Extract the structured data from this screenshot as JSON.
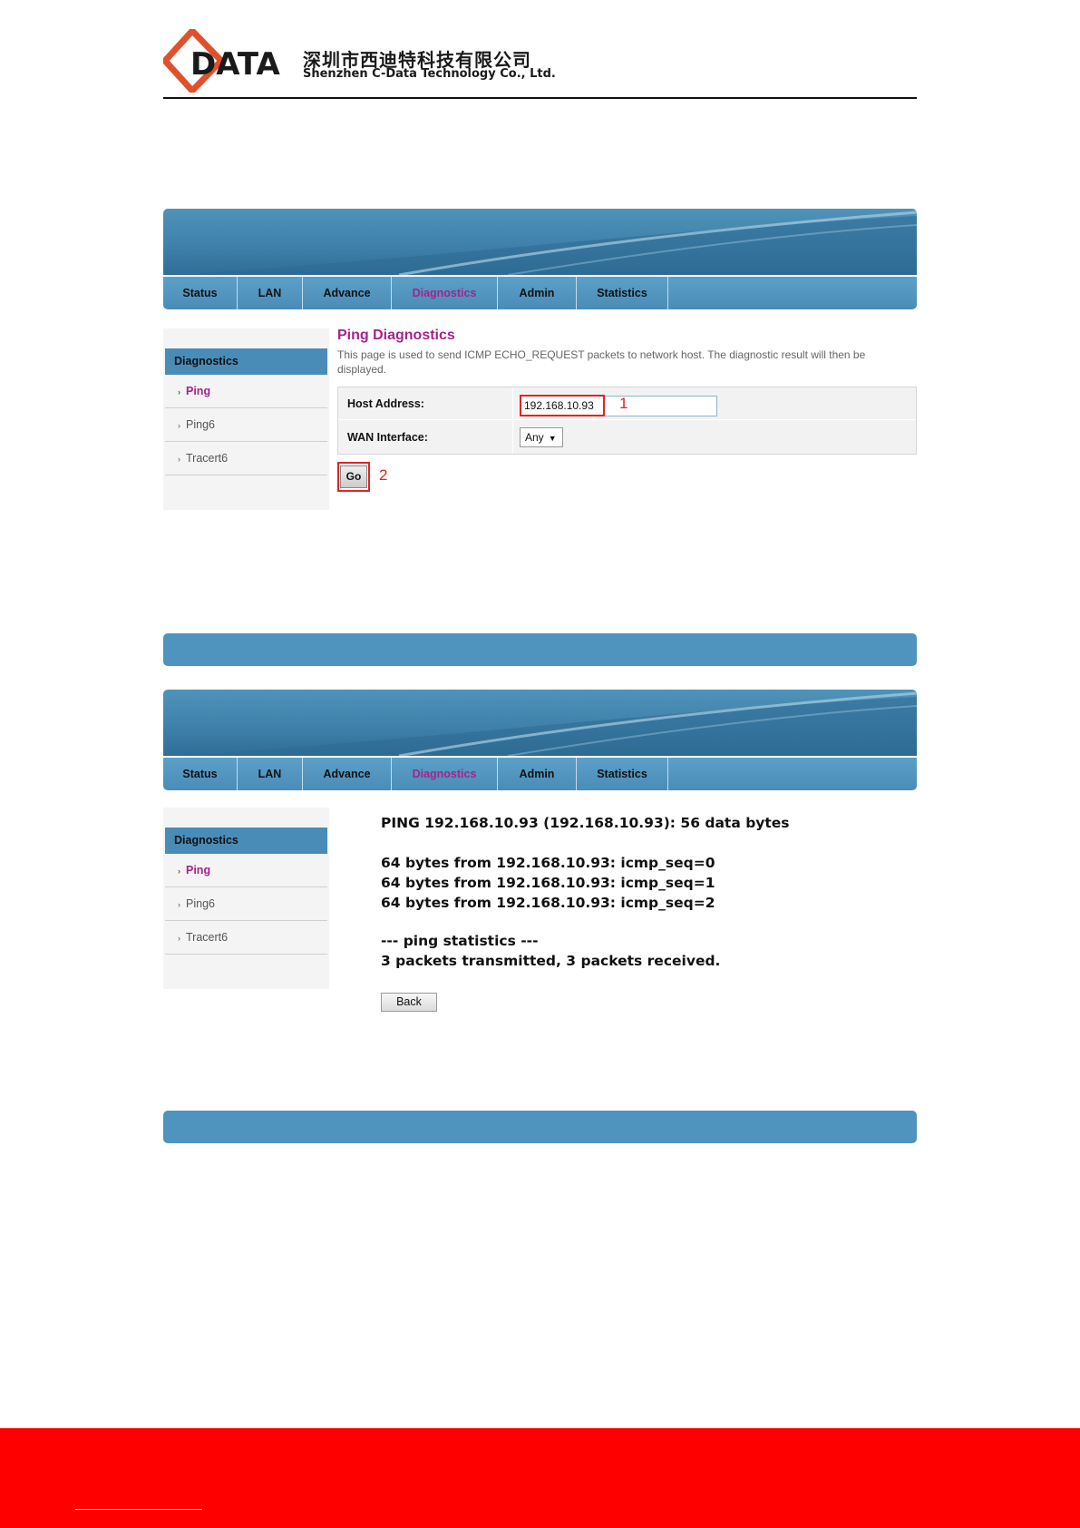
{
  "header": {
    "company_cn": "深圳市西迪特科技有限公司",
    "company_en": "Shenzhen C-Data Technology Co., Ltd.",
    "logo_text": "DATA"
  },
  "colors": {
    "accent_magenta": "#a3238e",
    "nav_blue": "#4a8cb8",
    "callout_red": "#e02424",
    "footer_red": "#ff0000"
  },
  "nav": {
    "tabs": [
      "Status",
      "LAN",
      "Advance",
      "Diagnostics",
      "Admin",
      "Statistics"
    ],
    "active": "Diagnostics"
  },
  "sidebar": {
    "title": "Diagnostics",
    "items": [
      "Ping",
      "Ping6",
      "Tracert6"
    ],
    "active": "Ping"
  },
  "ping_form": {
    "title": "Ping Diagnostics",
    "description": "This page is used to send ICMP ECHO_REQUEST packets to network host. The diagnostic result will then be displayed.",
    "host_label": "Host Address:",
    "host_value": "192.168.10.93",
    "wan_label": "WAN Interface:",
    "wan_value": "Any",
    "go_label": "Go",
    "callout_1": "1",
    "callout_2": "2"
  },
  "ping_result": {
    "lines": [
      "PING 192.168.10.93 (192.168.10.93): 56 data bytes",
      "64 bytes from 192.168.10.93: icmp_seq=0",
      "64 bytes from 192.168.10.93: icmp_seq=1",
      "64 bytes from 192.168.10.93: icmp_seq=2",
      "--- ping statistics ---",
      "3 packets transmitted, 3 packets received."
    ],
    "back_label": "Back"
  }
}
